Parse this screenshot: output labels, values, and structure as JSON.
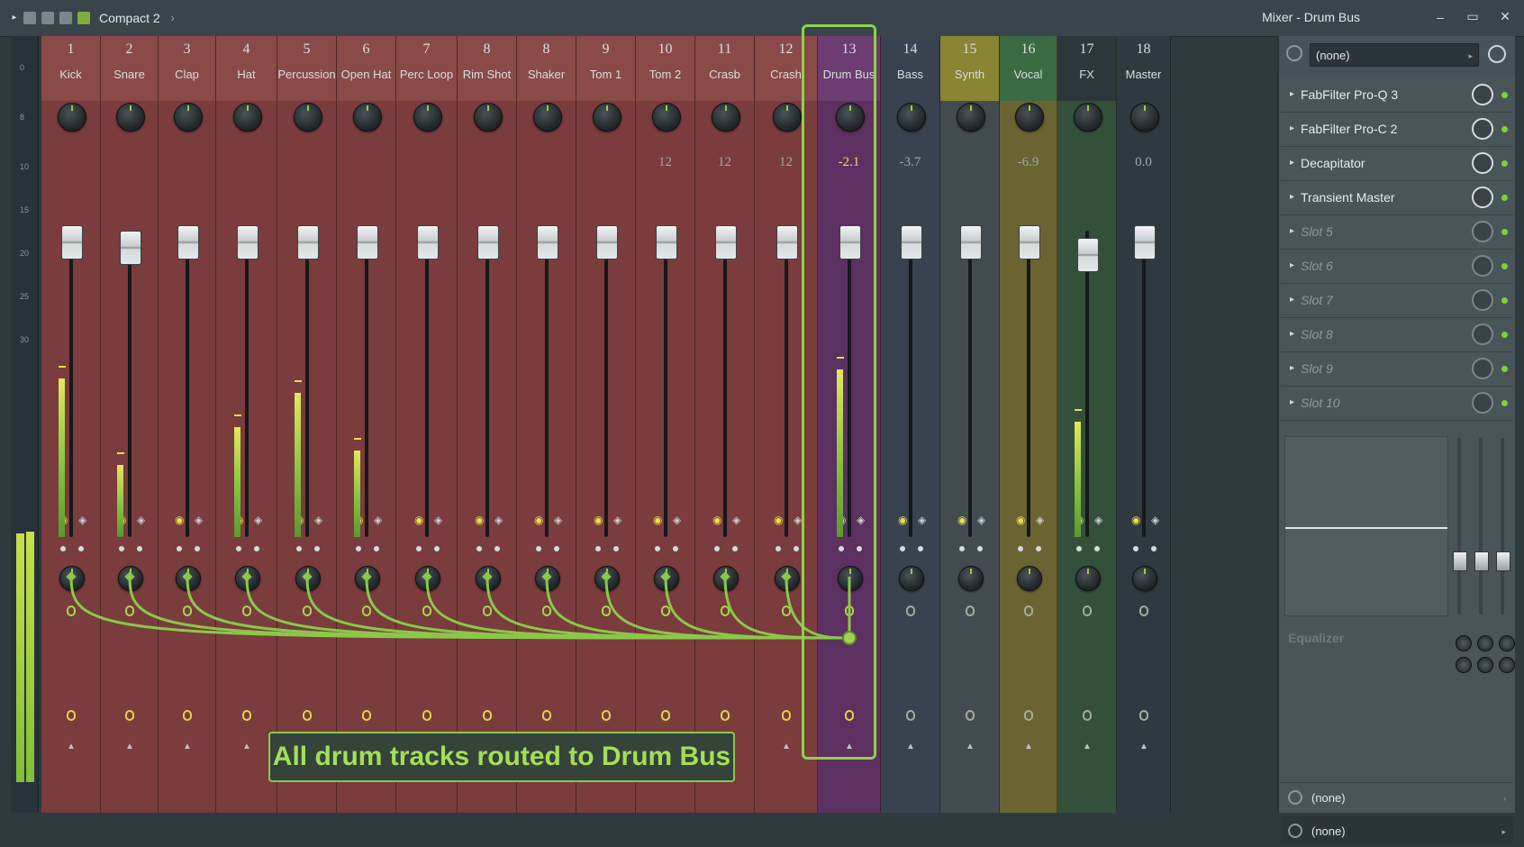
{
  "app": {
    "project_title": "Compact 2",
    "window_title": "Mixer - Drum Bus",
    "controls": {
      "minimize": "–",
      "maximize": "▭",
      "close": "✕"
    }
  },
  "ruler_marks": [
    "0",
    "8",
    "10",
    "15",
    "20",
    "25",
    "30"
  ],
  "tracks": [
    {
      "num": "1",
      "name": "Kick",
      "readout": "",
      "color": "#7a3c3c",
      "meter": 0.55,
      "fader": 0.05
    },
    {
      "num": "2",
      "name": "Snare",
      "readout": "",
      "color": "#7a3c3c",
      "meter": 0.25,
      "fader": 0.08
    },
    {
      "num": "3",
      "name": "Clap",
      "readout": "",
      "color": "#7a3c3c",
      "meter": 0,
      "fader": 0.05
    },
    {
      "num": "4",
      "name": "Hat",
      "readout": "",
      "color": "#7a3c3c",
      "meter": 0.38,
      "fader": 0.05
    },
    {
      "num": "5",
      "name": "Percussion",
      "readout": "",
      "color": "#7a3c3c",
      "meter": 0.5,
      "fader": 0.05
    },
    {
      "num": "6",
      "name": "Open Hat",
      "readout": "",
      "color": "#7a3c3c",
      "meter": 0.3,
      "fader": 0.05
    },
    {
      "num": "7",
      "name": "Perc Loop",
      "readout": "",
      "color": "#7a3c3c",
      "meter": 0,
      "fader": 0.05
    },
    {
      "num": "8",
      "name": "Rim Shot",
      "readout": "",
      "color": "#7a3c3c",
      "meter": 0,
      "fader": 0.05
    },
    {
      "num": "8",
      "name": "Shaker",
      "readout": "",
      "color": "#7a3c3c",
      "meter": 0,
      "fader": 0.05
    },
    {
      "num": "9",
      "name": "Tom 1",
      "readout": "",
      "color": "#7a3c3c",
      "meter": 0,
      "fader": 0.05
    },
    {
      "num": "10",
      "name": "Tom 2",
      "readout": "12",
      "color": "#7a3c3c",
      "meter": 0,
      "fader": 0.05
    },
    {
      "num": "11",
      "name": "Crasb",
      "readout": "12",
      "color": "#7a3c3c",
      "meter": 0,
      "fader": 0.05
    },
    {
      "num": "12",
      "name": "Crash",
      "readout": "12",
      "color": "#7a3c3c",
      "meter": 0,
      "fader": 0.05
    },
    {
      "num": "13",
      "name": "Drum Bus",
      "readout": "-2.1",
      "color": "#5c3060",
      "meter": 0.58,
      "fader": 0.05
    },
    {
      "num": "14",
      "name": "Bass",
      "readout": "-3.7",
      "color": "#39424f",
      "meter": 0,
      "fader": 0.05
    },
    {
      "num": "15",
      "name": "Synth",
      "readout": "",
      "color": "#414b50",
      "meter": 0,
      "fader": 0.05
    },
    {
      "num": "16",
      "name": "Vocal",
      "readout": "-6.9",
      "color": "#6a6433",
      "meter": 0,
      "fader": 0.05
    },
    {
      "num": "17",
      "name": "FX",
      "readout": "",
      "color": "#34503a",
      "meter": 0.4,
      "fader": 0.12
    },
    {
      "num": "18",
      "name": "Master",
      "readout": "0.0",
      "color": "#2e3a40",
      "meter": 0,
      "fader": 0.05
    }
  ],
  "callout": {
    "text": "All drum tracks routed to Drum Bus"
  },
  "panel": {
    "input": "(none)",
    "slots": [
      {
        "label": "FabFilter Pro-Q 3",
        "empty": false
      },
      {
        "label": "FabFilter Pro-C 2",
        "empty": false
      },
      {
        "label": "Decapitator",
        "empty": false
      },
      {
        "label": "Transient Master",
        "empty": false
      },
      {
        "label": "Slot 5",
        "empty": true
      },
      {
        "label": "Slot 6",
        "empty": true
      },
      {
        "label": "Slot 7",
        "empty": true
      },
      {
        "label": "Slot 8",
        "empty": true
      },
      {
        "label": "Slot 9",
        "empty": true
      },
      {
        "label": "Slot 10",
        "empty": true
      }
    ],
    "eq_label": "Equalizer",
    "bottom_1": "(none)",
    "output": "(none)"
  },
  "colors": {
    "accent": "#8fd04b",
    "route": "#8ac84a",
    "drum_bus": "#5c3060"
  }
}
